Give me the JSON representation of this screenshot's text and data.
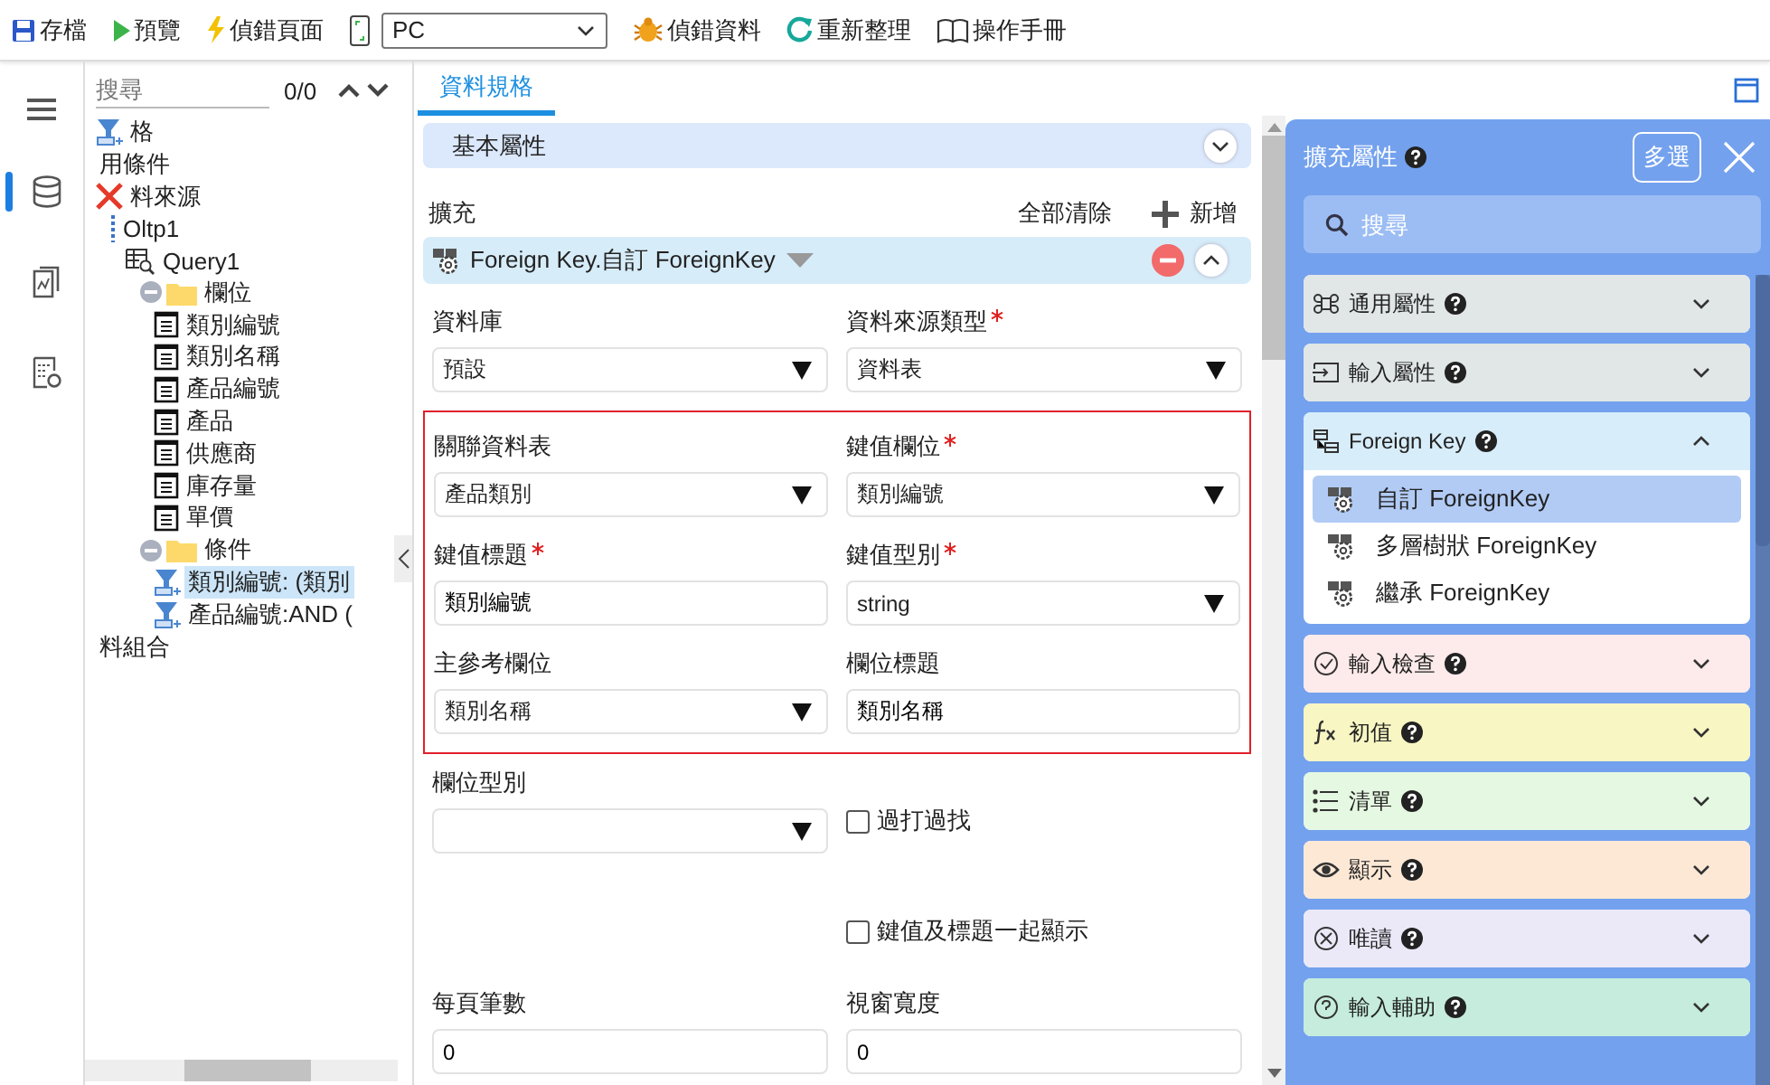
{
  "toolbar": [
    {
      "kind": "button",
      "label": "存檔"
    },
    {
      "kind": "button",
      "label": "預覽"
    },
    {
      "kind": "button",
      "label": "偵錯頁面"
    },
    {
      "kind": "select",
      "value": "PC"
    },
    {
      "kind": "button",
      "label": "偵錯資料"
    },
    {
      "kind": "button",
      "label": "重新整理"
    },
    {
      "kind": "button",
      "label": "操作手冊"
    }
  ],
  "rail": [
    {
      "selected": true
    },
    {
      "selected": false
    },
    {
      "selected": false
    }
  ],
  "tree": {
    "search": {
      "placeholder": "搜尋"
    },
    "count": "0/0",
    "nodes": [
      {
        "kind": "filter",
        "label": "格",
        "selected": false
      },
      {
        "kind": "plain",
        "label": "用條件",
        "selected": false
      },
      {
        "kind": "error",
        "label": "料來源",
        "selected": false,
        "children": [
          {
            "kind": "connection",
            "label": "Oltp1",
            "selected": false,
            "children": [
              {
                "kind": "query",
                "label": "Query1",
                "selected": false,
                "children": [
                  {
                    "kind": "folder",
                    "label": "欄位",
                    "expanded": true,
                    "selected": false,
                    "children": [
                      {
                        "kind": "field",
                        "label": "類別編號",
                        "selected": false
                      },
                      {
                        "kind": "field",
                        "label": "類別名稱",
                        "selected": false
                      },
                      {
                        "kind": "field",
                        "label": "產品編號",
                        "selected": false
                      },
                      {
                        "kind": "field",
                        "label": "產品",
                        "selected": false
                      },
                      {
                        "kind": "field",
                        "label": "供應商",
                        "selected": false
                      },
                      {
                        "kind": "field",
                        "label": "庫存量",
                        "selected": false
                      },
                      {
                        "kind": "field",
                        "label": "單價",
                        "selected": false
                      }
                    ]
                  },
                  {
                    "kind": "folder",
                    "label": "條件",
                    "expanded": true,
                    "selected": false,
                    "children": [
                      {
                        "kind": "filter",
                        "label": "類別編號: (類別",
                        "selected": true
                      },
                      {
                        "kind": "filter",
                        "label": "產品編號:AND (",
                        "selected": false
                      }
                    ]
                  }
                ]
              }
            ]
          }
        ]
      },
      {
        "kind": "plain",
        "label": "料組合",
        "selected": false
      }
    ]
  },
  "tabs": [
    {
      "label": "資料規格",
      "selected": true
    }
  ],
  "section": {
    "title": "基本屬性",
    "expanded": false
  },
  "extension": {
    "label": "擴充",
    "clear_all": "全部清除",
    "add": "新增",
    "card": {
      "title": "Foreign Key.自訂 ForeignKey",
      "expanded": true,
      "fields": [
        {
          "kind": "select",
          "label": "資料庫",
          "required": false,
          "value": "預設"
        },
        {
          "kind": "select",
          "label": "資料來源類型",
          "required": true,
          "value": "資料表"
        }
      ],
      "highlighted_fields": [
        {
          "kind": "select",
          "label": "關聯資料表",
          "required": false,
          "value": "產品類別"
        },
        {
          "kind": "select",
          "label": "鍵值欄位",
          "required": true,
          "value": "類別編號"
        },
        {
          "kind": "text",
          "label": "鍵值標題",
          "required": true,
          "value": "類別編號"
        },
        {
          "kind": "select",
          "label": "鍵值型別",
          "required": true,
          "value": "string"
        },
        {
          "kind": "select",
          "label": "主參考欄位",
          "required": false,
          "value": "類別名稱"
        },
        {
          "kind": "text",
          "label": "欄位標題",
          "required": false,
          "value": "類別名稱"
        }
      ],
      "more_fields": [
        {
          "kind": "select",
          "label": "欄位型別",
          "required": false
        },
        {
          "kind": "checkbox",
          "label": "過打過找",
          "checked": false
        },
        {
          "kind": "checkbox",
          "label": "鍵值及標題一起顯示",
          "checked": false
        },
        {
          "kind": "text",
          "label": "每頁筆數",
          "required": false,
          "value": "0"
        },
        {
          "kind": "text",
          "label": "視窗寬度",
          "required": false,
          "value": "0"
        }
      ]
    }
  },
  "panel": {
    "title": "擴充屬性",
    "multi_select": "多選",
    "search": {
      "placeholder": "搜尋"
    },
    "groups": [
      {
        "label": "通用屬性",
        "color": "#e1e6e6",
        "expanded": false
      },
      {
        "label": "輸入屬性",
        "color": "#e1e6e6",
        "expanded": false
      },
      {
        "label": "Foreign Key",
        "color": "#d7edf9",
        "expanded": true,
        "items": [
          {
            "label": "自訂 ForeignKey",
            "selected": true
          },
          {
            "label": "多層樹狀 ForeignKey",
            "selected": false
          },
          {
            "label": "繼承 ForeignKey",
            "selected": false
          }
        ]
      },
      {
        "label": "輸入檢查",
        "color": "#fdeaea",
        "expanded": false
      },
      {
        "label": "初值",
        "color": "#f8f6c3",
        "expanded": false
      },
      {
        "label": "清單",
        "color": "#e5f8e1",
        "expanded": false
      },
      {
        "label": "顯示",
        "color": "#fde8d6",
        "expanded": false
      },
      {
        "label": "唯讀",
        "color": "#ebe8f8",
        "expanded": false
      },
      {
        "label": "輸入輔助",
        "color": "#c5ecdc",
        "expanded": false
      }
    ]
  }
}
